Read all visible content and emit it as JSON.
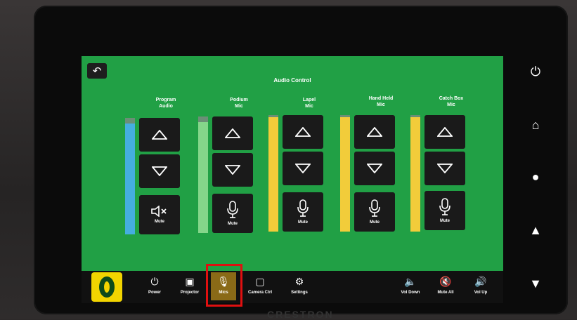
{
  "header": {
    "title": "Audio Control",
    "back_icon": "back-arrow-icon"
  },
  "channels": [
    {
      "label_line1": "Program",
      "label_line2": "Audio",
      "level": 0.95,
      "meter_color": "#45aee0",
      "muted": true,
      "mute_label": "Mute"
    },
    {
      "label_line1": "Podium",
      "label_line2": "Mic",
      "level": 0.95,
      "meter_color": "#85d68a",
      "muted": false,
      "mute_label": "Mute"
    },
    {
      "label_line1": "Lapel",
      "label_line2": "Mic",
      "level": 0.98,
      "meter_color": "#f2cc3a",
      "muted": false,
      "mute_label": "Mute"
    },
    {
      "label_line1": "Hand Held",
      "label_line2": "Mic",
      "level": 0.98,
      "meter_color": "#f2cc3a",
      "muted": false,
      "mute_label": "Mute"
    },
    {
      "label_line1": "Catch Box",
      "label_line2": "Mic",
      "level": 0.98,
      "meter_color": "#f2cc3a",
      "muted": false,
      "mute_label": "Mute"
    }
  ],
  "nav": {
    "power": "Power",
    "projector": "Projector",
    "mics": "Mics",
    "camera": "Camera Ctrl",
    "settings": "Settings",
    "vol_down": "Vol Down",
    "mute_all": "Mute All",
    "vol_up": "Vol Up",
    "active": "mics"
  },
  "brand": "CRESTRON",
  "colors": {
    "screen_bg": "#21a045",
    "active_nav": "#8a6a17",
    "logo_yellow": "#f2d400",
    "highlight": "#e01010"
  }
}
